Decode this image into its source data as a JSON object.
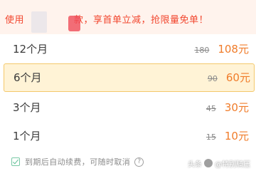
{
  "banner": {
    "text_prefix": "使用",
    "text_suffix": "款，享首单立减，抢限量免单！",
    "accent_color": "#f2472f"
  },
  "plans": [
    {
      "name": "12个月",
      "original_price": "180",
      "price": "108",
      "unit": "元",
      "selected": false
    },
    {
      "name": "6个月",
      "original_price": "90",
      "price": "60",
      "unit": "元",
      "selected": true
    },
    {
      "name": "3个月",
      "original_price": "45",
      "price": "30",
      "unit": "元",
      "selected": false
    },
    {
      "name": "1个月",
      "original_price": "15",
      "price": "10",
      "unit": "元",
      "selected": false
    }
  ],
  "auto_renew": {
    "checked": true,
    "label": "到期后自动续费，可随时取消",
    "help_icon": "question-circle-icon"
  },
  "watermark": {
    "prefix": "头条",
    "handle": "@特别騎压"
  },
  "colors": {
    "price": "#f07c2a",
    "selected_bg": "#fff3d6",
    "selected_border": "#f4c86b",
    "check": "#5fbf95"
  }
}
